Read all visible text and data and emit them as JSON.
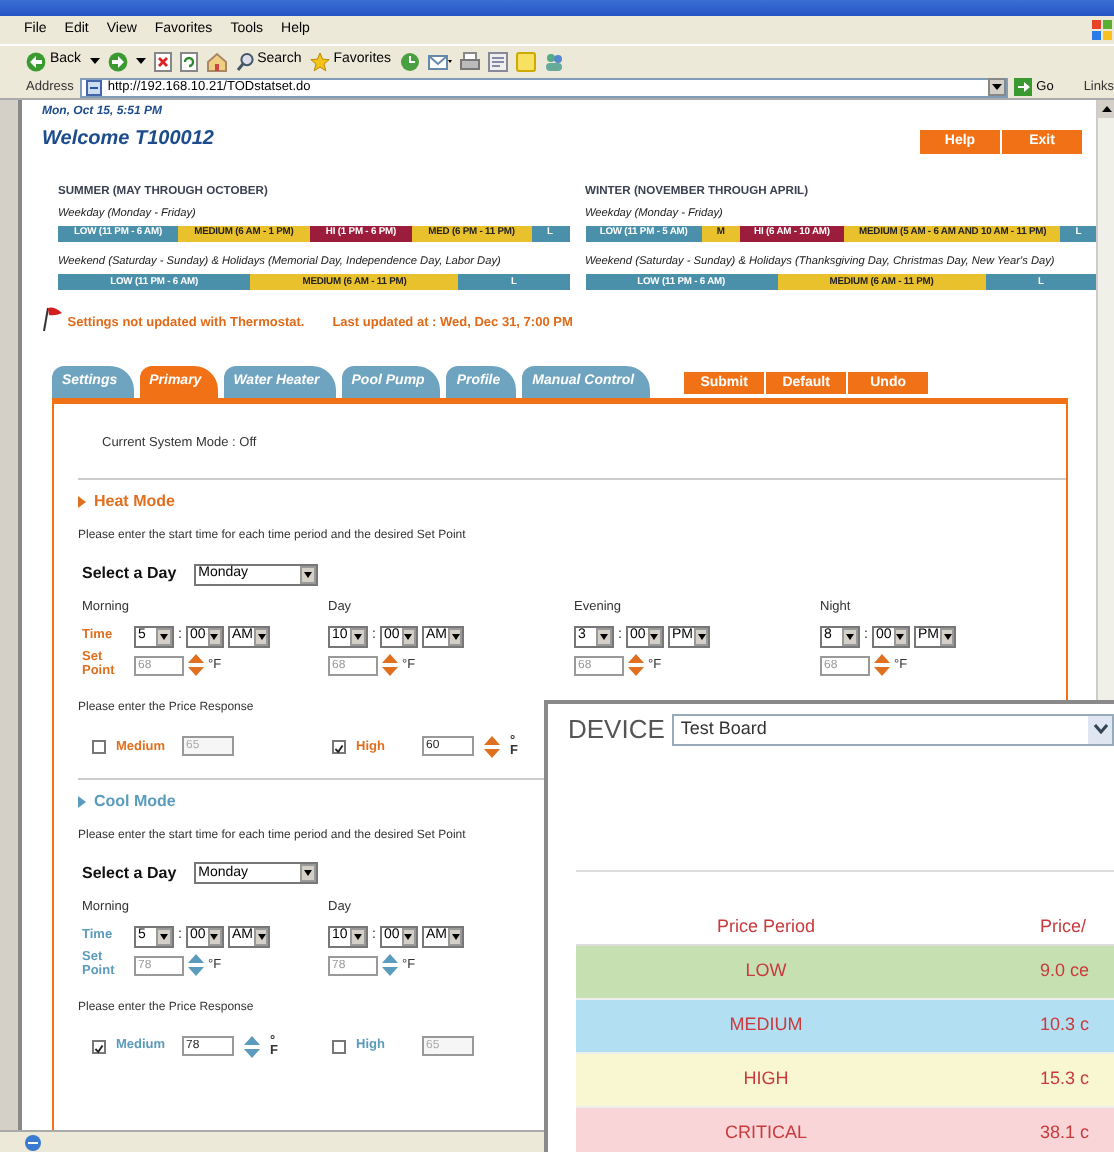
{
  "browser": {
    "menu": [
      "File",
      "Edit",
      "View",
      "Favorites",
      "Tools",
      "Help"
    ],
    "toolbar": {
      "back": "Back",
      "search": "Search",
      "favorites": "Favorites"
    },
    "address": {
      "label": "Address",
      "url": "http://192.168.10.21/TODstatset.do",
      "go": "Go",
      "links": "Links"
    }
  },
  "header": {
    "datetime": "Mon, Oct 15, 5:51 PM",
    "welcome": "Welcome T100012",
    "buttons": [
      "Help",
      "Exit"
    ]
  },
  "schedules": [
    {
      "season": "SUMMER (MAY THROUGH OCTOBER)",
      "rows": [
        {
          "label": "Weekday (Monday - Friday)",
          "segments": [
            {
              "text": "LOW (11 PM - 6 AM)",
              "kind": "low"
            },
            {
              "text": "MEDIUM (6 AM - 1 PM)",
              "kind": "medium"
            },
            {
              "text": "HI (1 PM - 6 PM)",
              "kind": "high"
            },
            {
              "text": "MED (6 PM - 11 PM)",
              "kind": "medium"
            },
            {
              "text": "L",
              "kind": "low"
            }
          ]
        },
        {
          "label": "Weekend (Saturday - Sunday) & Holidays (Memorial Day, Independence Day, Labor Day)",
          "segments": [
            {
              "text": "LOW (11 PM - 6 AM)",
              "kind": "low"
            },
            {
              "text": "MEDIUM (6 AM - 11 PM)",
              "kind": "medium"
            },
            {
              "text": "L",
              "kind": "low"
            }
          ]
        }
      ]
    },
    {
      "season": "WINTER (NOVEMBER THROUGH APRIL)",
      "rows": [
        {
          "label": "Weekday (Monday - Friday)",
          "segments": [
            {
              "text": "LOW (11 PM - 5 AM)",
              "kind": "low"
            },
            {
              "text": "M",
              "kind": "medium"
            },
            {
              "text": "HI (6 AM - 10 AM)",
              "kind": "high"
            },
            {
              "text": "MEDIUM (5 AM - 6 AM AND 10 AM - 11 PM)",
              "kind": "medium"
            },
            {
              "text": "L",
              "kind": "low"
            }
          ]
        },
        {
          "label": "Weekend (Saturday - Sunday) & Holidays (Thanksgiving Day, Christmas Day, New Year's Day)",
          "segments": [
            {
              "text": "LOW (11 PM - 6 AM)",
              "kind": "low"
            },
            {
              "text": "MEDIUM (6 AM - 11 PM)",
              "kind": "medium"
            },
            {
              "text": "L",
              "kind": "low"
            }
          ]
        }
      ]
    }
  ],
  "notice": {
    "message": "Settings not updated with Thermostat.",
    "updated": "Last updated at : Wed, Dec 31, 7:00 PM"
  },
  "tabs": [
    {
      "label": "Settings",
      "selected": false
    },
    {
      "label": "Primary",
      "selected": true
    },
    {
      "label": "Water Heater",
      "selected": false
    },
    {
      "label": "Pool Pump",
      "selected": false
    },
    {
      "label": "Profile",
      "selected": false
    },
    {
      "label": "Manual Control",
      "selected": false
    }
  ],
  "actions": [
    "Submit",
    "Default",
    "Undo"
  ],
  "system_mode": "Current System Mode : Off",
  "modes": [
    {
      "kind": "heat",
      "title": "Heat Mode",
      "instruction": "Please enter the start time for each time period and the desired Set Point",
      "day_label": "Select a Day",
      "day": "Monday",
      "periods": [
        {
          "name": "Morning",
          "time_label": "Time",
          "set_point_label": "Set Point",
          "hour": "5",
          "separator": ":",
          "minute": "00",
          "ampm": "AM",
          "set_point": "68",
          "unit": "°F"
        },
        {
          "name": "Day",
          "hour": "10",
          "separator": ":",
          "minute": "00",
          "ampm": "AM",
          "set_point": "68",
          "unit": "°F"
        },
        {
          "name": "Evening",
          "hour": "3",
          "separator": ":",
          "minute": "00",
          "ampm": "PM",
          "set_point": "68",
          "unit": "°F"
        },
        {
          "name": "Night",
          "hour": "8",
          "separator": ":",
          "minute": "00",
          "ampm": "PM",
          "set_point": "68",
          "unit": "°F"
        }
      ],
      "price_label": "Please enter the Price Response",
      "responses": [
        {
          "label": "Medium",
          "checked": false,
          "value": "65"
        },
        {
          "label": "High",
          "checked": true,
          "value": "60",
          "unit": "°F"
        }
      ]
    },
    {
      "kind": "cool",
      "title": "Cool Mode",
      "instruction": "Please enter the start time for each time period and the desired Set Point",
      "day_label": "Select a Day",
      "day": "Monday",
      "periods": [
        {
          "name": "Morning",
          "time_label": "Time",
          "set_point_label": "Set Point",
          "hour": "5",
          "separator": ":",
          "minute": "00",
          "ampm": "AM",
          "set_point": "78",
          "unit": "°F"
        },
        {
          "name": "Day",
          "hour": "10",
          "separator": ":",
          "minute": "00",
          "ampm": "AM",
          "set_point": "78",
          "unit": "°F"
        }
      ],
      "price_label": "Please enter the Price Response",
      "responses": [
        {
          "label": "Medium",
          "checked": true,
          "value": "78",
          "unit": "°F"
        },
        {
          "label": "High",
          "checked": false,
          "value": "65"
        }
      ]
    }
  ],
  "device_window": {
    "label": "DEVICE",
    "device": "Test Board",
    "columns": [
      "Price Period",
      "Price/"
    ],
    "rows": [
      {
        "period": "LOW",
        "price": "9.0 ce",
        "color": "#c6e0b2"
      },
      {
        "period": "MEDIUM",
        "price": "10.3 c",
        "color": "#b3dff2"
      },
      {
        "period": "HIGH",
        "price": "15.3 c",
        "color": "#f8f7d2"
      },
      {
        "period": "CRITICAL",
        "price": "38.1 c",
        "color": "#f9d5d8"
      }
    ]
  }
}
